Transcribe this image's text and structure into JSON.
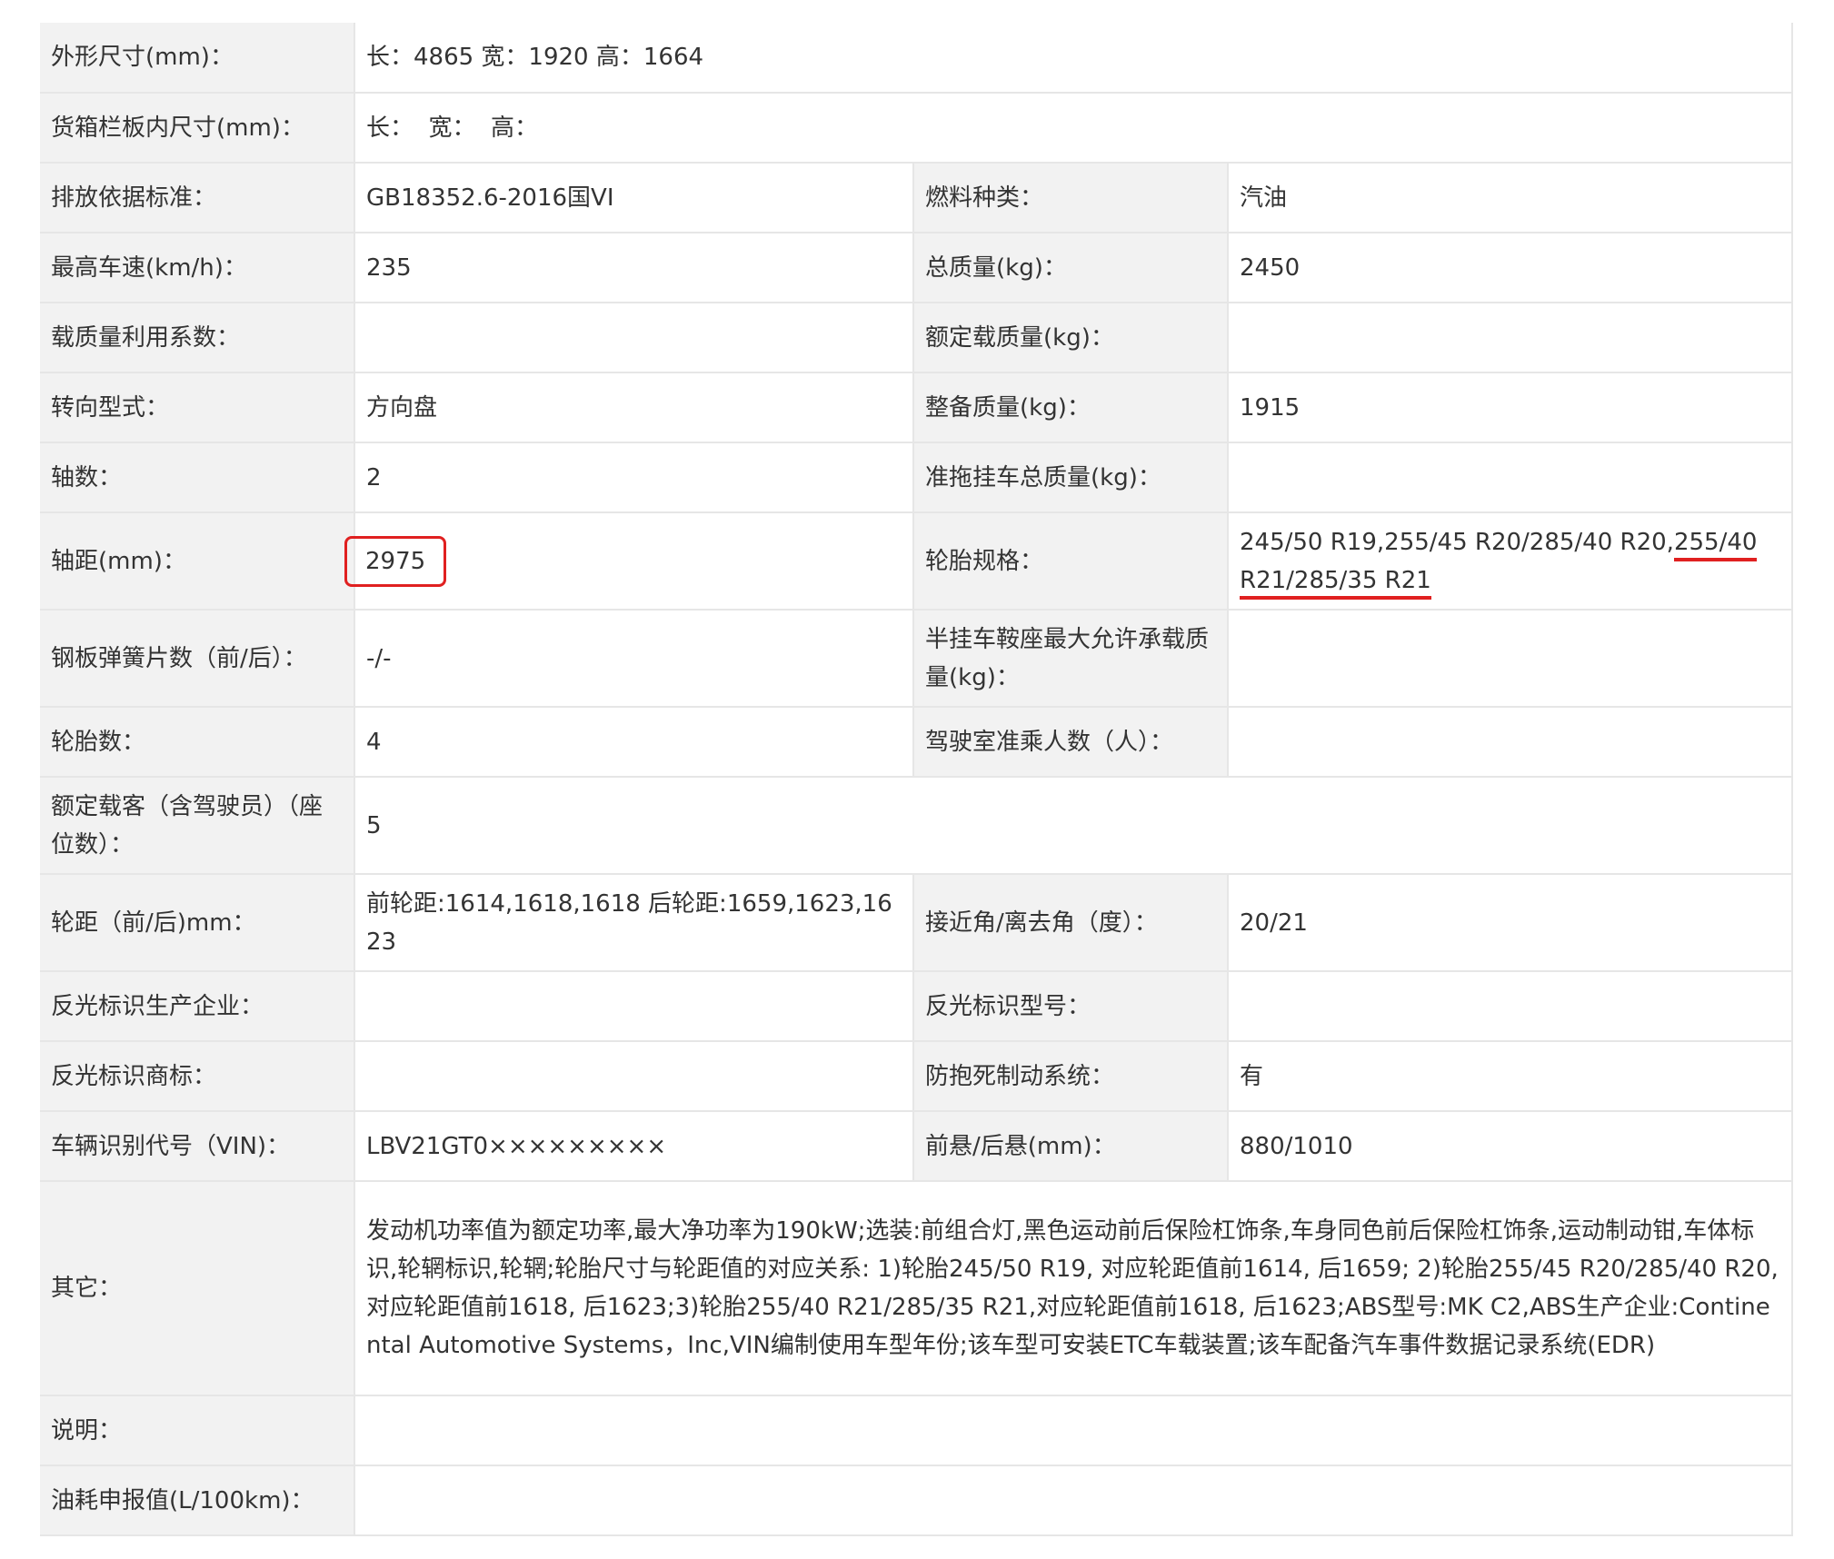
{
  "rows": [
    {
      "k": "外形尺寸(mm)：",
      "v": "长：4865 宽：1920 高：1664"
    },
    {
      "k": "货箱栏板内尺寸(mm)：",
      "v": "长：  宽：  高："
    },
    {
      "k": "排放依据标准：",
      "v": "GB18352.6-2016国VI",
      "k2": "燃料种类：",
      "v2": "汽油"
    },
    {
      "k": "最高车速(km/h)：",
      "v": "235",
      "k2": "总质量(kg)：",
      "v2": "2450"
    },
    {
      "k": "载质量利用系数：",
      "v": "",
      "k2": "额定载质量(kg)：",
      "v2": ""
    },
    {
      "k": "转向型式：",
      "v": "方向盘",
      "k2": "整备质量(kg)：",
      "v2": "1915"
    },
    {
      "k": "轴数：",
      "v": "2",
      "k2": "准拖挂车总质量(kg)：",
      "v2": ""
    },
    {
      "k": "轴距(mm)：",
      "v": "2975",
      "k2": "轮胎规格：",
      "v2a": "245/50 R19,255/45 R20/285/40 R20,",
      "v2b": "255/40 R21/285/35 R21"
    },
    {
      "k": "钢板弹簧片数（前/后）：",
      "v": "-/-",
      "k2": "半挂车鞍座最大允许承载质量(kg)：",
      "v2": ""
    },
    {
      "k": "轮胎数：",
      "v": "4",
      "k2": "驾驶室准乘人数（人）：",
      "v2": ""
    },
    {
      "k": "额定载客（含驾驶员）（座位数）：",
      "v": "5"
    },
    {
      "k": "轮距（前/后)mm：",
      "v": "前轮距:1614,1618,1618 后轮距:1659,1623,1623",
      "k2": "接近角/离去角（度）：",
      "v2": "20/21"
    },
    {
      "k": "反光标识生产企业：",
      "v": "",
      "k2": "反光标识型号：",
      "v2": ""
    },
    {
      "k": "反光标识商标：",
      "v": "",
      "k2": "防抱死制动系统：",
      "v2": "有"
    },
    {
      "k": "车辆识别代号（VIN)：",
      "v": "LBV21GT0×××××××××",
      "k2": "前悬/后悬(mm)：",
      "v2": "880/1010"
    },
    {
      "k": "其它：",
      "v": "发动机功率值为额定功率,最大净功率为190kW;选装:前组合灯,黑色运动前后保险杠饰条,车身同色前后保险杠饰条,运动制动钳,车体标识,轮辋标识,轮辋;轮胎尺寸与轮距值的对应关系: 1)轮胎245/50 R19, 对应轮距值前1614, 后1659; 2)轮胎255/45 R20/285/40 R20,对应轮距值前1618, 后1623;3)轮胎255/40 R21/285/35 R21,对应轮距值前1618, 后1623;ABS型号:MK C2,ABS生产企业:Continental Automotive Systems，Inc,VIN编制使用车型年份;该车型可安装ETC车载装置;该车配备汽车事件数据记录系统(EDR)"
    },
    {
      "k": "说明：",
      "v": ""
    },
    {
      "k": "油耗申报值(L/100km)：",
      "v": ""
    }
  ],
  "colors": {
    "highlight": "#e02020",
    "label_bg": "#f2f2f2",
    "border": "#e6e6e6"
  }
}
